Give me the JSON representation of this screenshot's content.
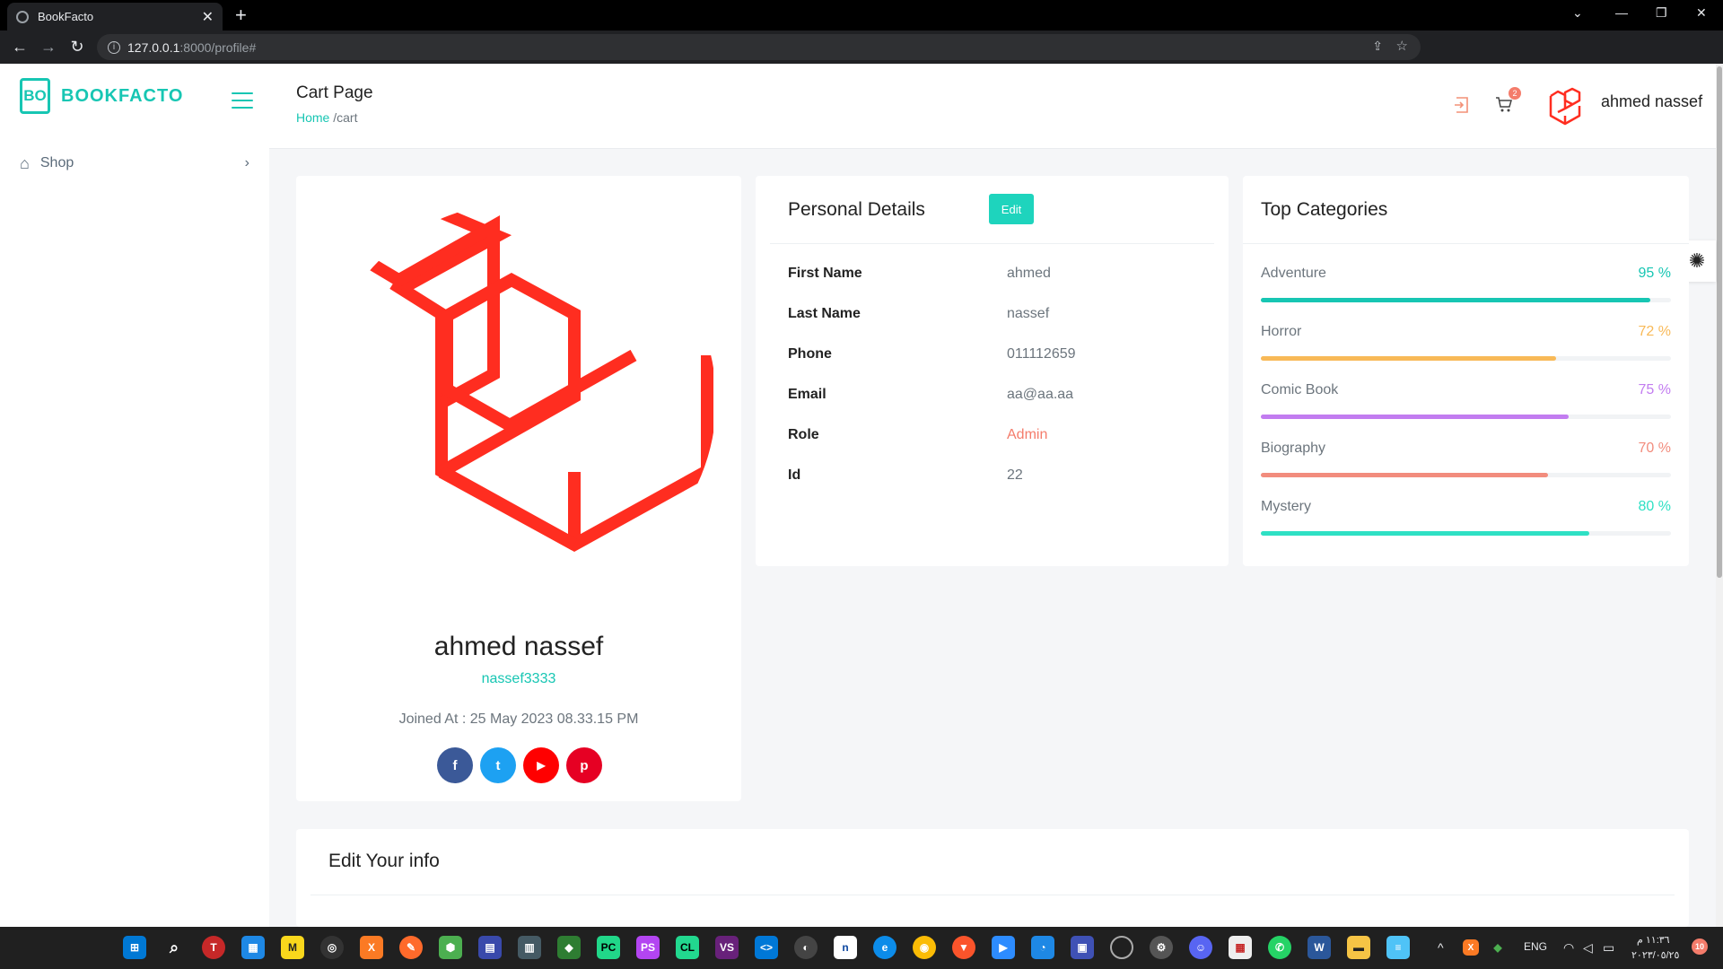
{
  "browser": {
    "tab_title": "BookFacto",
    "tab_close": "✕",
    "new_tab": "+",
    "url_host": "127.0.0.1",
    "url_rest": ":8000/profile#",
    "ctl_min": "—",
    "ctl_restore": "❐",
    "ctl_close": "✕",
    "ctl_dropdown": "⌄"
  },
  "sidebar": {
    "brand_logo": "BO",
    "brand_name": "BOOKFACTO",
    "items": [
      {
        "label": "Shop",
        "icon": "home-icon"
      }
    ]
  },
  "header": {
    "title": "Cart Page",
    "breadcrumb_home": "Home",
    "breadcrumb_current": " /cart",
    "cart_count": "2",
    "user_name": "ahmed nassef"
  },
  "profile": {
    "name": "ahmed nassef",
    "handle": "nassef3333",
    "joined": "Joined At : 25 May 2023 08.33.15 PM",
    "socials": [
      {
        "name": "facebook",
        "glyph": "f",
        "color": "#3b5998"
      },
      {
        "name": "twitter",
        "glyph": "t",
        "color": "#1da1f2"
      },
      {
        "name": "youtube",
        "glyph": "▶",
        "color": "#ff0000"
      },
      {
        "name": "pinterest",
        "glyph": "p",
        "color": "#e60023"
      }
    ]
  },
  "details": {
    "title": "Personal Details",
    "edit_label": "Edit",
    "rows": [
      {
        "key": "First Name",
        "value": "ahmed"
      },
      {
        "key": "Last Name",
        "value": "nassef"
      },
      {
        "key": "Phone",
        "value": "011112659"
      },
      {
        "key": "Email",
        "value": "aa@aa.aa"
      },
      {
        "key": "Role",
        "value": "Admin"
      },
      {
        "key": "Id",
        "value": "22"
      }
    ]
  },
  "categories": {
    "title": "Top Categories",
    "items": [
      {
        "name": "Adventure",
        "percent_label": "95 %",
        "percent": 95,
        "color": "#17c6b3"
      },
      {
        "name": "Horror",
        "percent_label": "72 %",
        "percent": 72,
        "color": "#f8b957"
      },
      {
        "name": "Comic Book",
        "percent_label": "75 %",
        "percent": 75,
        "color": "#c27cf0"
      },
      {
        "name": "Biography",
        "percent_label": "70 %",
        "percent": 70,
        "color": "#f28c7d"
      },
      {
        "name": "Mystery",
        "percent_label": "80 %",
        "percent": 80,
        "color": "#2ee0c4"
      }
    ]
  },
  "edit_section": {
    "title": "Edit Your info"
  },
  "taskbar": {
    "lang": "ENG",
    "time": "١١:٣٦ م",
    "date": "٢٠٢٣/٠٥/٢٥",
    "notif_count": "10"
  },
  "colors": {
    "accent": "#17c6b3",
    "laravel_red": "#ff2d20",
    "badge": "#f47c6b"
  }
}
